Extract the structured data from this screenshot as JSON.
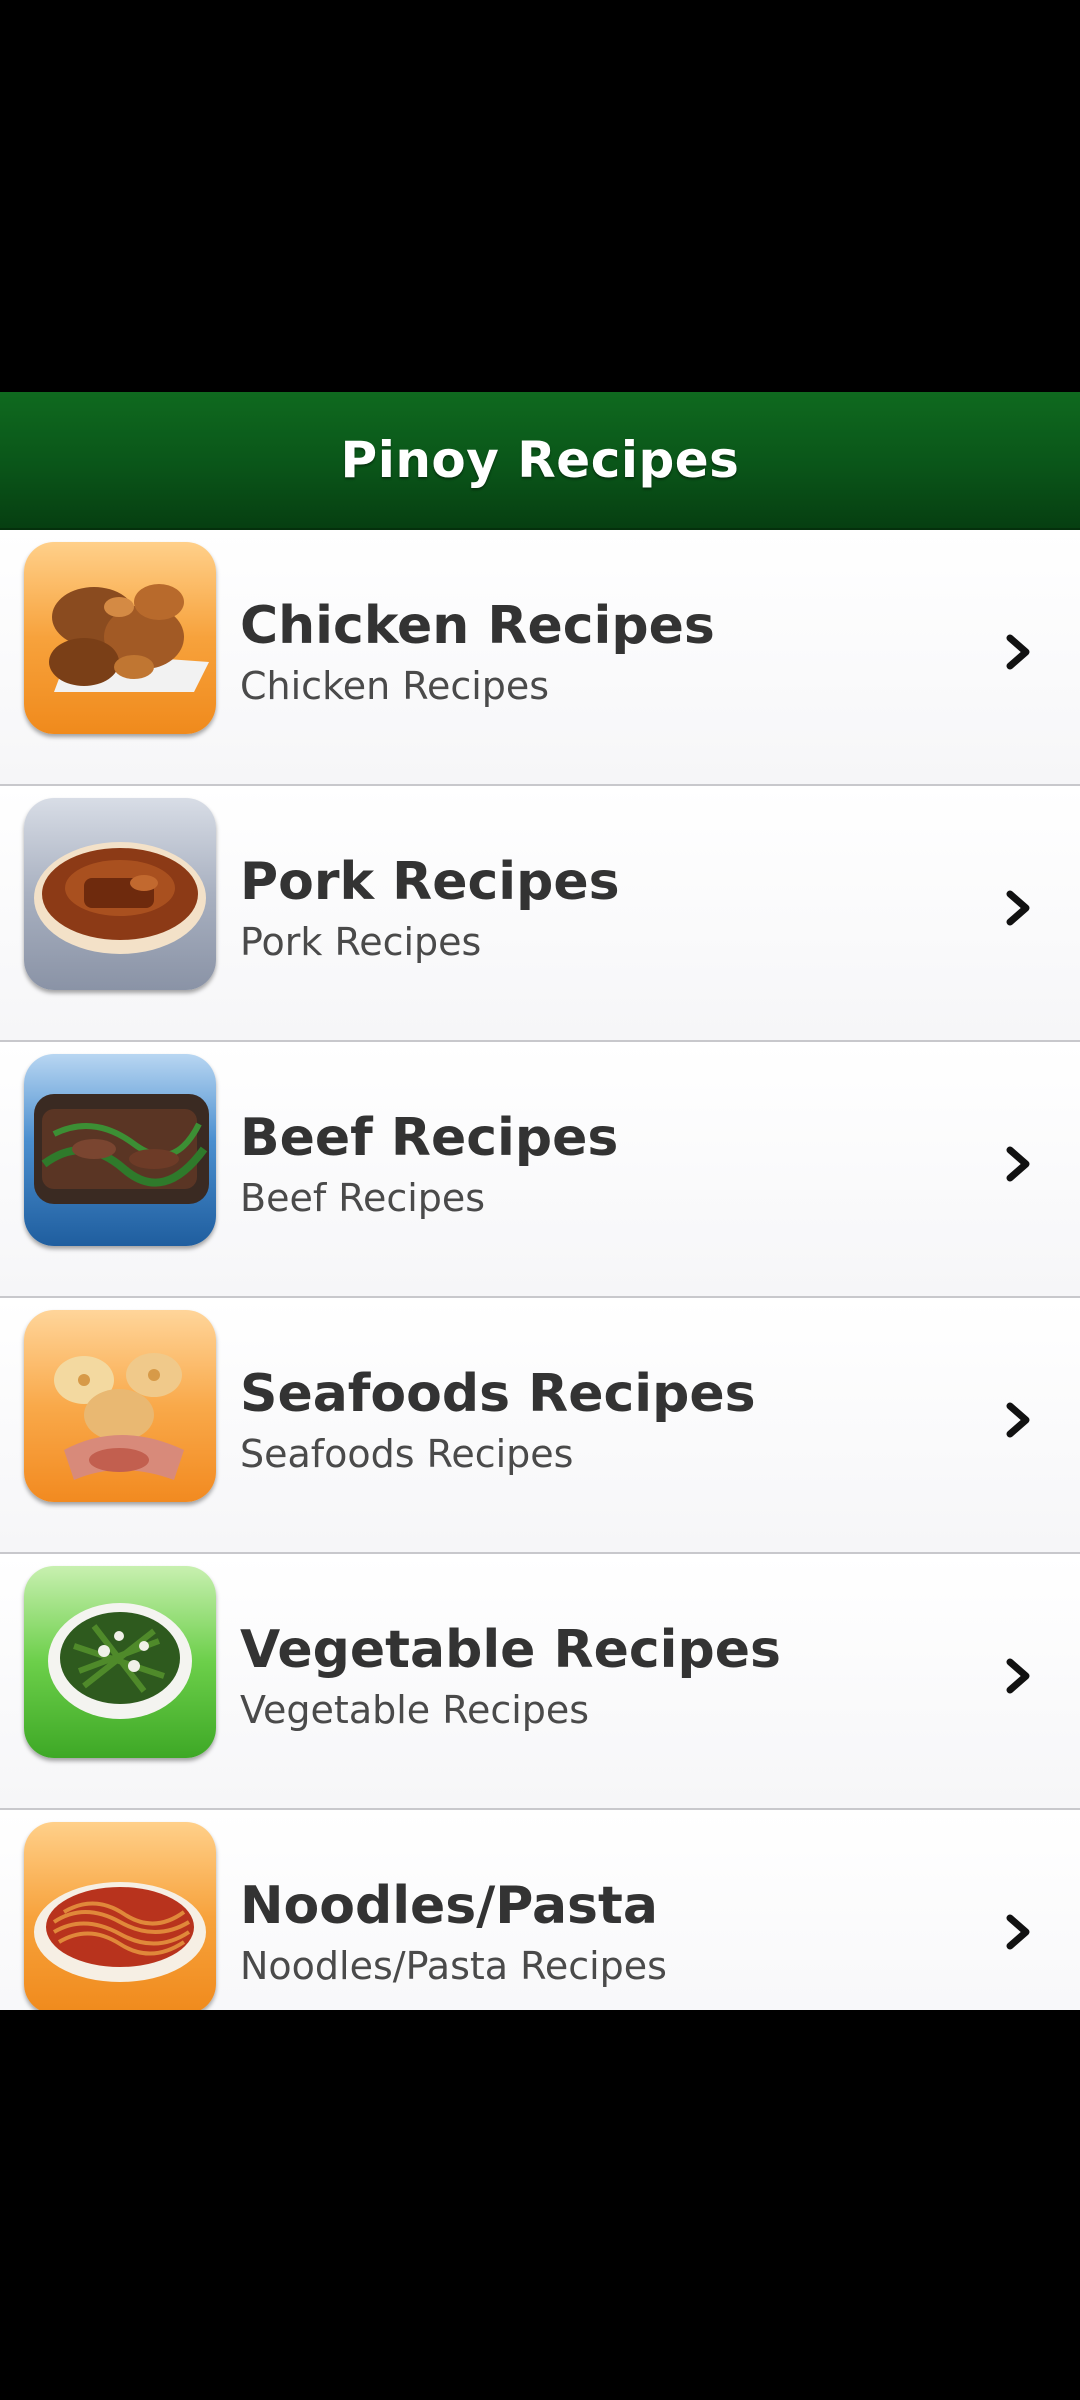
{
  "header": {
    "title": "Pinoy Recipes"
  },
  "categories": [
    {
      "title": "Chicken Recipes",
      "subtitle": "Chicken Recipes",
      "icon": "chicken-dish-icon"
    },
    {
      "title": "Pork Recipes",
      "subtitle": "Pork Recipes",
      "icon": "pork-dish-icon"
    },
    {
      "title": "Beef Recipes",
      "subtitle": "Beef Recipes",
      "icon": "beef-dish-icon"
    },
    {
      "title": "Seafoods Recipes",
      "subtitle": "Seafoods Recipes",
      "icon": "seafood-dish-icon"
    },
    {
      "title": "Vegetable Recipes",
      "subtitle": "Vegetable Recipes",
      "icon": "vegetable-dish-icon"
    },
    {
      "title": "Noodles/Pasta",
      "subtitle": "Noodles/Pasta Recipes",
      "icon": "noodles-dish-icon"
    }
  ],
  "colors": {
    "header_green": "#0a5519",
    "title_text": "#333333",
    "subtitle_text": "#4a4a4a",
    "row_divider": "#c8c8cc"
  }
}
